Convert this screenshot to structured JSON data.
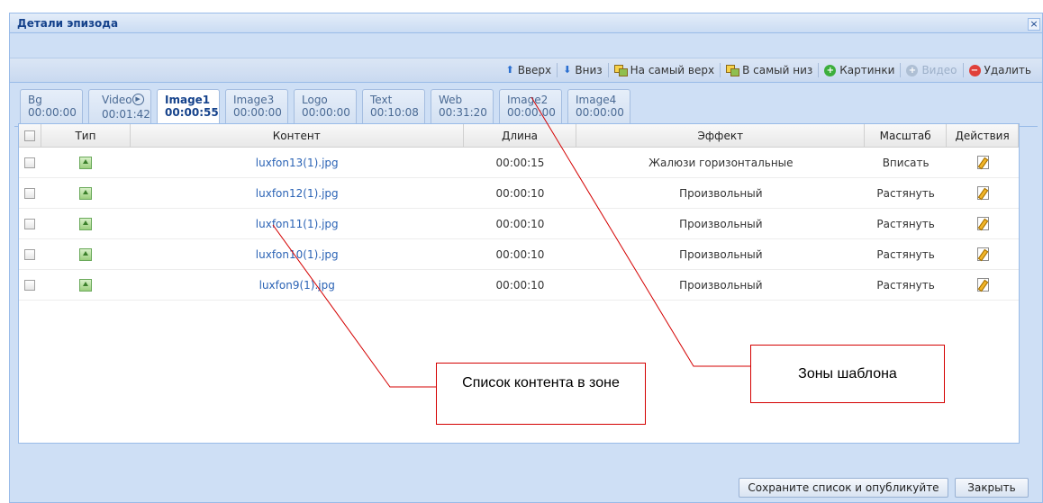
{
  "window": {
    "title": "Детали эпизода",
    "close_glyph": "×"
  },
  "toolbar": {
    "up": "Вверх",
    "down": "Вниз",
    "to_top": "На самый верх",
    "to_bottom": "В самый низ",
    "pictures": "Картинки",
    "video": "Видео",
    "delete": "Удалить"
  },
  "tabs": [
    {
      "name": "Bg",
      "time": "00:00:00",
      "active": false
    },
    {
      "name": "Video",
      "time": "00:01:42",
      "active": false,
      "icon": "play-icon"
    },
    {
      "name": "Image1",
      "time": "00:00:55",
      "active": true
    },
    {
      "name": "Image3",
      "time": "00:00:00",
      "active": false
    },
    {
      "name": "Logo",
      "time": "00:00:00",
      "active": false
    },
    {
      "name": "Text",
      "time": "00:10:08",
      "active": false
    },
    {
      "name": "Web",
      "time": "00:31:20",
      "active": false
    },
    {
      "name": "Image2",
      "time": "00:00:00",
      "active": false
    },
    {
      "name": "Image4",
      "time": "00:00:00",
      "active": false
    }
  ],
  "grid": {
    "columns": [
      "Тип",
      "Контент",
      "Длина",
      "Эффект",
      "Масштаб",
      "Действия"
    ],
    "rows": [
      {
        "content": "luxfon13(1).jpg",
        "length": "00:00:15",
        "effect": "Жалюзи горизонтальные",
        "scale": "Вписать"
      },
      {
        "content": "luxfon12(1).jpg",
        "length": "00:00:10",
        "effect": "Произвольный",
        "scale": "Растянуть"
      },
      {
        "content": "luxfon11(1).jpg",
        "length": "00:00:10",
        "effect": "Произвольный",
        "scale": "Растянуть"
      },
      {
        "content": "luxfon10(1).jpg",
        "length": "00:00:10",
        "effect": "Произвольный",
        "scale": "Растянуть"
      },
      {
        "content": "luxfon9(1).jpg",
        "length": "00:00:10",
        "effect": "Произвольный",
        "scale": "Растянуть"
      }
    ]
  },
  "footer": {
    "save_publish": "Сохраните список и опубликуйте",
    "close": "Закрыть"
  },
  "annotations": {
    "content_list": "Список контента в зоне",
    "template_zones": "Зоны шаблона"
  },
  "colors": {
    "accent": "#15428b",
    "callout_border": "#d40000",
    "link": "#2b63b5"
  }
}
